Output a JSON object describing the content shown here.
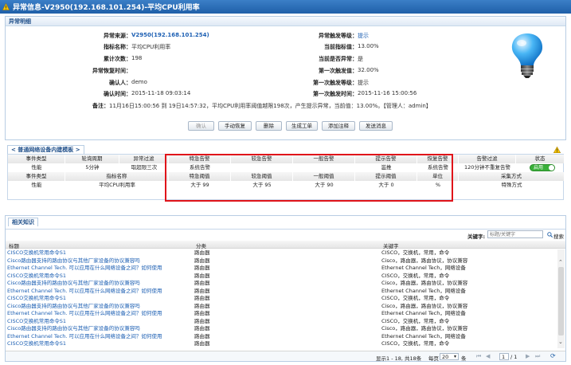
{
  "window": {
    "title": "异常信息-V2950(192.168.101.254)-平均CPU利用率",
    "icon": "warning-icon",
    "accent": "#1f5fa8"
  },
  "detail": {
    "heading": "异常明细",
    "rows": [
      {
        "label": "异常来源：",
        "value": "V2950(192.168.101.254)",
        "link": true
      },
      {
        "label": "指标名称：",
        "value": "平均CPU利用率"
      },
      {
        "label": "累计次数：",
        "value": "198"
      },
      {
        "label": "异常恢复时间：",
        "value": ""
      },
      {
        "label": "确认人：",
        "value": "demo"
      },
      {
        "label": "确认时间：",
        "value": "2015-11-18 09:03:14"
      }
    ],
    "rows_right": [
      {
        "label": "异常触发等级：",
        "value": "提示",
        "link": true
      },
      {
        "label": "当前指标值：",
        "value": "13.00%"
      },
      {
        "label": "当前是否异常：",
        "value": "是"
      },
      {
        "label": "第一次触发值：",
        "value": "32.00%"
      },
      {
        "label": "第一次触发等级：",
        "value": "提示"
      },
      {
        "label": "第一次触发时间：",
        "value": "2015-11-16 15:00:56"
      }
    ],
    "remark_label": "备注：",
    "remark_value": "11月16日15:00:56 到 19日14:57:32，平均CPU利用率阈值越限198次，产生提示异常，当前值：13.00%。【管理人：admin】",
    "lightbulb_icon": "lightbulb-icon"
  },
  "actions": {
    "confirm": "确认",
    "manual_recover": "手动恢复",
    "delete": "删除",
    "create_ticket": "生成工单",
    "add_comment": "添加注释",
    "send_message": "发送消息"
  },
  "template": {
    "tab_label": "< 普通网络设备内建模板 >",
    "warning_icon": "warning-icon",
    "header1": [
      "事件类型",
      "轮询周期",
      "异常过滤",
      "特急告警",
      "较急告警",
      "一般告警",
      "提示告警",
      "恢复告警",
      "告警过滤",
      "状态"
    ],
    "row1": [
      "性能",
      "5分钟",
      "取超限三次",
      "系统告警",
      "",
      "",
      "滥推",
      "系统告警",
      "120分钟不重复告警",
      "启用"
    ],
    "header2": [
      "事件类型",
      "指标名称",
      "特急阈值",
      "较急阈值",
      "一般阈值",
      "提示阈值",
      "单位",
      "采集方式"
    ],
    "row2": [
      "性能",
      "平均CPU利用率",
      "大于 99",
      "大于 95",
      "大于 90",
      "大于 0",
      "%",
      "特殊方式"
    ],
    "toggle_color": "#3ab03a"
  },
  "knowledge": {
    "tab_label": "相关知识",
    "search_label": "关键字:",
    "search_placeholder": "标题/关键字",
    "search_button": "搜索",
    "columns": [
      "标题",
      "分类",
      "关键字"
    ],
    "rows": [
      [
        "CISCO交换机常用命令S1",
        "路由器",
        "CISCO，交换机，常用，命令"
      ],
      [
        "Cisco路由器支持的路由协议与其他厂家设备的协议兼容吗",
        "路由器",
        "Cisco，路由器，路由协议，协议兼容"
      ],
      [
        "Ethernet Channel Tech. 可以应用在什么网络设备之间？如何使用",
        "路由器",
        "Ethernet Channel Tech，网络设备"
      ],
      [
        "CISCO交换机常用命令S1",
        "路由器",
        "CISCO，交换机，常用，命令"
      ],
      [
        "Cisco路由器支持的路由协议与其他厂家设备的协议兼容吗",
        "路由器",
        "Cisco，路由器，路由协议，协议兼容"
      ],
      [
        "Ethernet Channel Tech. 可以应用在什么网络设备之间？如何使用",
        "路由器",
        "Ethernet Channel Tech，网络设备"
      ],
      [
        "CISCO交换机常用命令S1",
        "路由器",
        "CISCO，交换机，常用，命令"
      ],
      [
        "Cisco路由器支持的路由协议与其他厂家设备的协议兼容吗",
        "路由器",
        "Cisco，路由器，路由协议，协议兼容"
      ],
      [
        "Ethernet Channel Tech. 可以应用在什么网络设备之间？如何使用",
        "路由器",
        "Ethernet Channel Tech，网络设备"
      ],
      [
        "CISCO交换机常用命令S1",
        "路由器",
        "CISCO，交换机，常用，命令"
      ],
      [
        "Cisco路由器支持的路由协议与其他厂家设备的协议兼容吗",
        "路由器",
        "Cisco，路由器，路由协议，协议兼容"
      ],
      [
        "Ethernet Channel Tech. 可以应用在什么网络设备之间？如何使用",
        "路由器",
        "Ethernet Channel Tech，网络设备"
      ],
      [
        "CISCO交换机常用命令S1",
        "路由器",
        "CISCO，交换机，常用，命令"
      ]
    ],
    "pager": {
      "summary": "显示1 - 18, 共18条",
      "per_page_label": "每页",
      "per_page": "20",
      "per_page_unit": "条",
      "page": "1",
      "of": "/ 1"
    }
  }
}
